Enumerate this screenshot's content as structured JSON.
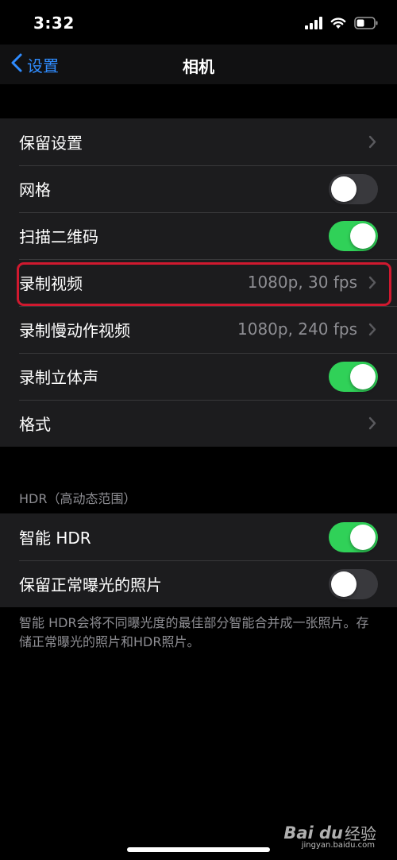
{
  "status_bar": {
    "time": "3:32"
  },
  "nav": {
    "back_label": "设置",
    "title": "相机"
  },
  "group1": {
    "rows": [
      {
        "label": "保留设置",
        "value": ""
      },
      {
        "label": "网格",
        "toggle": false
      },
      {
        "label": "扫描二维码",
        "toggle": true
      },
      {
        "label": "录制视频",
        "value": "1080p, 30 fps"
      },
      {
        "label": "录制慢动作视频",
        "value": "1080p, 240 fps"
      },
      {
        "label": "录制立体声",
        "toggle": true
      },
      {
        "label": "格式",
        "value": ""
      }
    ]
  },
  "hdr_section": {
    "header": "HDR（高动态范围）",
    "rows": [
      {
        "label": "智能 HDR",
        "toggle": true
      },
      {
        "label": "保留正常曝光的照片",
        "toggle": false
      }
    ],
    "footer": "智能 HDR会将不同曝光度的最佳部分智能合并成一张照片。存储正常曝光的照片和HDR照片。"
  },
  "watermark": {
    "logo": "Bai du",
    "text": "经验",
    "url": "jingyan.baidu.com"
  },
  "colors": {
    "accent_blue": "#2f8cff",
    "toggle_on": "#30d158",
    "toggle_off": "#39393d",
    "highlight_red": "#d0192f",
    "cell_bg": "#1c1c1e"
  },
  "icons": [
    "cellular-signal-icon",
    "wifi-icon",
    "battery-icon",
    "chevron-left-icon",
    "chevron-right-icon"
  ]
}
